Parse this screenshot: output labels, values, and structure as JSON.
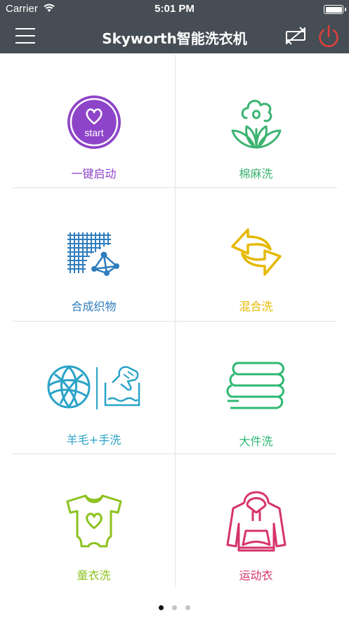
{
  "status_bar": {
    "carrier": "Carrier",
    "time": "5:01 PM"
  },
  "nav": {
    "title": "Skyworth智能洗衣机"
  },
  "modes": [
    {
      "label": "一键启动",
      "icon_text": "start",
      "icon": "heart-start-icon",
      "color": "#8e44c8"
    },
    {
      "label": "棉麻洗",
      "icon": "cotton-icon",
      "color": "#3cb371"
    },
    {
      "label": "合成织物",
      "icon": "synthetic-fabric-icon",
      "color": "#2f7dbd"
    },
    {
      "label": "混合洗",
      "icon": "mixed-arrows-icon",
      "color": "#e6b800"
    },
    {
      "label": "羊毛+手洗",
      "icon": "wool-handwash-icon",
      "color": "#2aa3c8"
    },
    {
      "label": "大件洗",
      "icon": "stacked-clothes-icon",
      "color": "#2eb872"
    },
    {
      "label": "童衣洗",
      "icon": "baby-onesie-icon",
      "color": "#8cc21e"
    },
    {
      "label": "运动衣",
      "icon": "hoodie-icon",
      "color": "#d6336c"
    }
  ],
  "pagination": {
    "active_index": 0,
    "count": 3,
    "active_color": "#111111",
    "inactive_color": "#c4c4c4"
  }
}
